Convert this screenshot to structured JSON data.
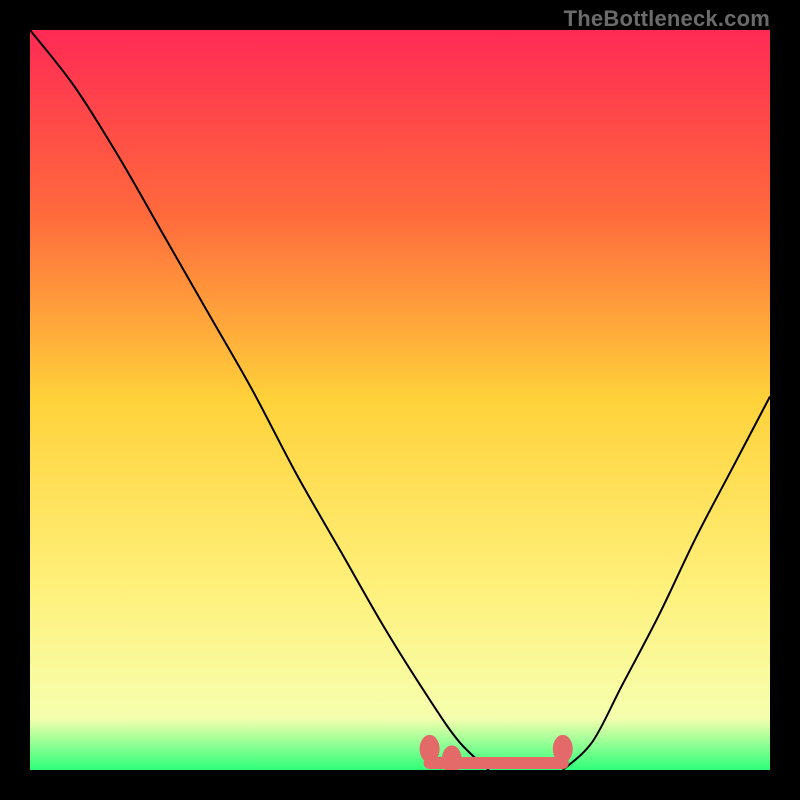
{
  "watermark": "TheBottleneck.com",
  "colors": {
    "gradient": [
      "#ff2a55",
      "#ff6a3c",
      "#ffd23a",
      "#fff07a",
      "#f6ffae",
      "#2dff7a"
    ],
    "curve": "#000000",
    "accent": "#e46a6a"
  },
  "chart_data": {
    "type": "line",
    "title": "",
    "xlabel": "",
    "ylabel": "",
    "xlim": [
      0,
      100
    ],
    "ylim": [
      0,
      105
    ],
    "series": [
      {
        "name": "left-curve",
        "x": [
          0,
          6,
          12,
          18,
          24,
          30,
          36,
          42,
          48,
          54,
          58,
          62
        ],
        "values": [
          105,
          97,
          87,
          76,
          65,
          54,
          42,
          31,
          20,
          10,
          4,
          0
        ]
      },
      {
        "name": "right-curve",
        "x": [
          72,
          76,
          80,
          85,
          90,
          95,
          100
        ],
        "values": [
          0,
          4,
          12,
          22,
          33,
          43,
          53
        ]
      },
      {
        "name": "flat-accent-segment",
        "x": [
          54,
          72
        ],
        "values": [
          1,
          1
        ]
      }
    ],
    "accent_markers": [
      {
        "x": 54,
        "y": 3
      },
      {
        "x": 57,
        "y": 1.5
      },
      {
        "x": 72,
        "y": 3
      }
    ]
  }
}
